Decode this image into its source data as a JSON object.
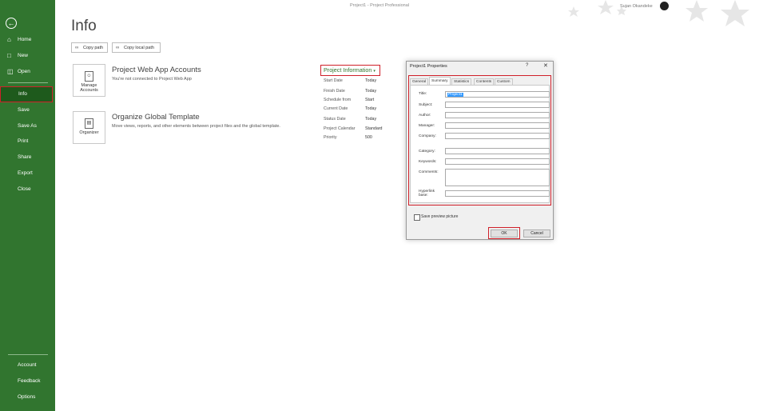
{
  "window": {
    "title": "Project1  -  Project Professional",
    "user": "Sujan Okandeke"
  },
  "sidebar": {
    "items": [
      {
        "label": "Home",
        "icon": "home-icon"
      },
      {
        "label": "New",
        "icon": "new-document-icon"
      },
      {
        "label": "Open",
        "icon": "folder-open-icon"
      },
      {
        "label": "Info"
      },
      {
        "label": "Save"
      },
      {
        "label": "Save As"
      },
      {
        "label": "Print"
      },
      {
        "label": "Share"
      },
      {
        "label": "Export"
      },
      {
        "label": "Close"
      }
    ],
    "bottom": [
      {
        "label": "Account"
      },
      {
        "label": "Feedback"
      },
      {
        "label": "Options"
      }
    ]
  },
  "main": {
    "title": "Info",
    "copy_path": "Copy path",
    "copy_local_path": "Copy local path",
    "manage_accounts": "Manage Accounts",
    "pwa_title": "Project Web App Accounts",
    "pwa_desc": "You're not connected to Project Web App",
    "organizer": "Organizer",
    "org_title": "Organize Global Template",
    "org_desc": "Move views, reports, and other elements between project files and the global template."
  },
  "project_info": {
    "header": "Project Information",
    "rows": [
      {
        "label": "Start Date",
        "value": "Today"
      },
      {
        "label": "Finish Date",
        "value": "Today"
      },
      {
        "label": "Schedule from",
        "value": "Start"
      },
      {
        "label": "Current Date",
        "value": "Today"
      },
      {
        "label": "Status Date",
        "value": "Today"
      },
      {
        "label": "Project Calendar",
        "value": "Standard"
      },
      {
        "label": "Priority",
        "value": "500"
      }
    ]
  },
  "dialog": {
    "title": "Project1 Properties",
    "help": "?",
    "close": "✕",
    "tabs": [
      "General",
      "Summary",
      "Statistics",
      "Contents",
      "Custom"
    ],
    "active_tab": "Summary",
    "fields": [
      {
        "label": "Title:",
        "value": "Project1"
      },
      {
        "label": "Subject:",
        "value": ""
      },
      {
        "label": "Author:",
        "value": ""
      },
      {
        "label": "Manager:",
        "value": ""
      },
      {
        "label": "Company:",
        "value": ""
      },
      {
        "label": "Category:",
        "value": ""
      },
      {
        "label": "Keywords:",
        "value": ""
      },
      {
        "label": "Comments:",
        "value": ""
      },
      {
        "label": "Hyperlink base:",
        "value": ""
      }
    ],
    "preview_label": "Save preview picture",
    "ok": "OK",
    "cancel": "Cancel"
  },
  "colors": {
    "sidebar": "#31752f",
    "highlight": "#d0202a",
    "accent": "#31752f"
  }
}
